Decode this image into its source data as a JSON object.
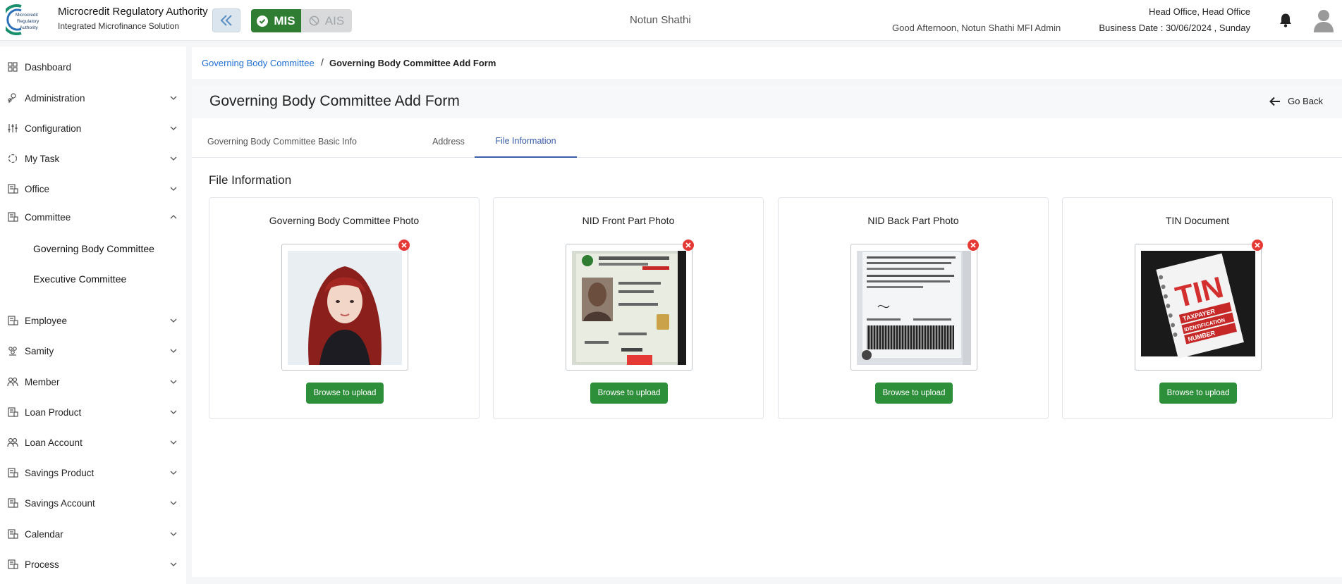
{
  "header": {
    "brand_title": "Microcredit Regulatory Authority",
    "brand_subtitle": "Integrated Microfinance Solution",
    "logo_text": "Microcredit Regulatory Authority",
    "mis_label": "MIS",
    "ais_label": "AIS",
    "org_name": "Notun Shathi",
    "greeting": "Good Afternoon, Notun Shathi MFI Admin",
    "office": "Head Office, Head Office",
    "business_date": "Business Date : 30/06/2024 , Sunday"
  },
  "sidebar": {
    "items": [
      {
        "label": "Dashboard",
        "icon": "dashboard-icon"
      },
      {
        "label": "Administration",
        "icon": "administration-icon"
      },
      {
        "label": "Configuration",
        "icon": "configuration-icon"
      },
      {
        "label": "My Task",
        "icon": "task-icon"
      },
      {
        "label": "Office",
        "icon": "office-icon"
      },
      {
        "label": "Committee",
        "icon": "committee-icon"
      },
      {
        "label": "Employee",
        "icon": "employee-icon"
      },
      {
        "label": "Samity",
        "icon": "samity-icon"
      },
      {
        "label": "Member",
        "icon": "member-icon"
      },
      {
        "label": "Loan Product",
        "icon": "loan-product-icon"
      },
      {
        "label": "Loan Account",
        "icon": "loan-account-icon"
      },
      {
        "label": "Savings Product",
        "icon": "savings-product-icon"
      },
      {
        "label": "Savings Account",
        "icon": "savings-account-icon"
      },
      {
        "label": "Calendar",
        "icon": "calendar-icon"
      },
      {
        "label": "Process",
        "icon": "process-icon"
      }
    ],
    "committee_sub": [
      "Governing Body Committee",
      "Executive Committee"
    ]
  },
  "breadcrumb": {
    "link": "Governing Body Committee",
    "separator": "/",
    "current": "Governing Body Committee Add Form"
  },
  "form": {
    "title": "Governing Body Committee Add Form",
    "go_back": "Go Back",
    "tabs": [
      "Governing Body Committee Basic Info",
      "Address",
      "File Information"
    ],
    "active_tab": "File Information",
    "section_title": "File Information",
    "upload_label": "Browse to upload",
    "cards": [
      {
        "title": "Governing Body Committee Photo",
        "kind": "portrait-photo"
      },
      {
        "title": "NID Front Part Photo",
        "kind": "nid-front"
      },
      {
        "title": "NID Back Part Photo",
        "kind": "nid-back"
      },
      {
        "title": "TIN Document",
        "kind": "tin-document",
        "image_text": [
          "TIN",
          "TAXPAYER",
          "IDENTIFICATION",
          "NUMBER"
        ]
      }
    ]
  },
  "colors": {
    "primary_green": "#2f7d33",
    "upload_green": "#2e8f3a",
    "link_blue": "#1f6fd1",
    "active_tab": "#3b5ea8",
    "remove_red": "#e53935"
  }
}
